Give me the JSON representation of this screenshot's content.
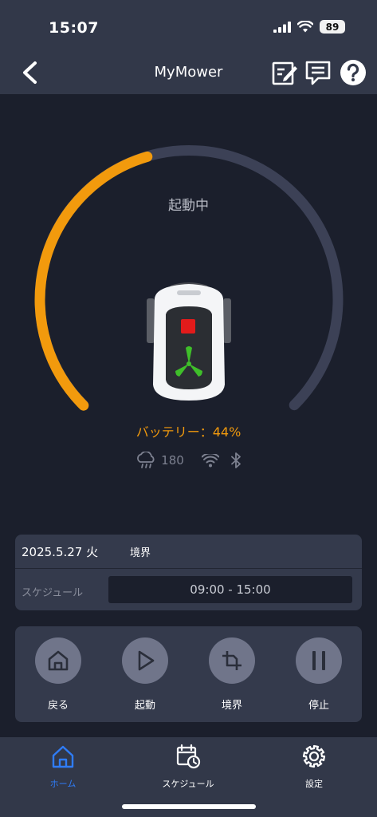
{
  "status_bar": {
    "time": "15:07",
    "battery": "89"
  },
  "header": {
    "title": "MyMower"
  },
  "gauge": {
    "status": "起動中",
    "battery_label": "バッテリー：44%",
    "battery_level": 0.44
  },
  "connectivity": {
    "rain_value": "180"
  },
  "info": {
    "date": "2025.5.27 火",
    "mode": "境界",
    "schedule_label": "スケジュール",
    "schedule_value": "09:00 - 15:00"
  },
  "controls": [
    {
      "label": "戻る",
      "icon": "home-icon"
    },
    {
      "label": "起動",
      "icon": "play-icon"
    },
    {
      "label": "境界",
      "icon": "boundary-icon"
    },
    {
      "label": "停止",
      "icon": "pause-icon"
    }
  ],
  "tabs": [
    {
      "label": "ホーム",
      "icon": "home-icon",
      "active": true
    },
    {
      "label": "スケジュール",
      "icon": "schedule-icon",
      "active": false
    },
    {
      "label": "設定",
      "icon": "gear-icon",
      "active": false
    }
  ],
  "colors": {
    "accent": "#f29a0d",
    "active_tab": "#2f7cf6",
    "background": "#1b1f2c",
    "panel": "#343a4c"
  }
}
